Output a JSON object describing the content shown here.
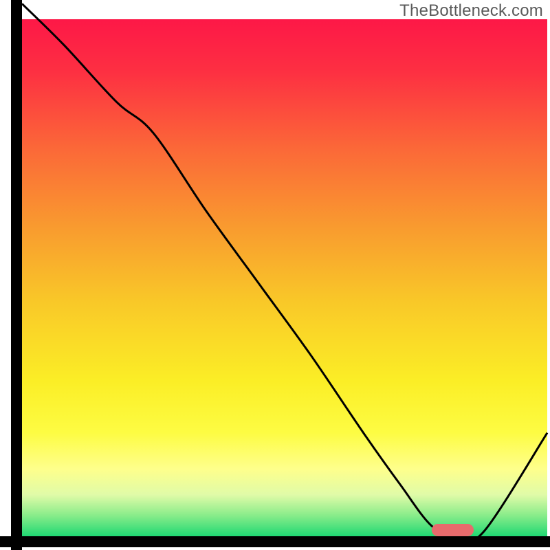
{
  "watermark": "TheBottleneck.com",
  "chart_data": {
    "type": "line",
    "title": "",
    "xlabel": "",
    "ylabel": "",
    "xlim": [
      0,
      100
    ],
    "ylim": [
      0,
      100
    ],
    "x": [
      0,
      8,
      18,
      25,
      35,
      45,
      55,
      65,
      72,
      78,
      83,
      88,
      100
    ],
    "values": [
      103,
      95,
      84,
      78,
      63,
      49,
      35,
      20,
      10,
      2,
      0,
      1,
      20
    ],
    "marker": {
      "x_start": 78,
      "x_end": 86,
      "y": 1.2
    },
    "gradient_stops": [
      {
        "offset": 0.0,
        "color": "#fd1847"
      },
      {
        "offset": 0.1,
        "color": "#fd2f42"
      },
      {
        "offset": 0.25,
        "color": "#fb6838"
      },
      {
        "offset": 0.4,
        "color": "#f99a2f"
      },
      {
        "offset": 0.55,
        "color": "#f9c928"
      },
      {
        "offset": 0.7,
        "color": "#fbee26"
      },
      {
        "offset": 0.8,
        "color": "#fdfc43"
      },
      {
        "offset": 0.87,
        "color": "#feff8c"
      },
      {
        "offset": 0.92,
        "color": "#e0fba8"
      },
      {
        "offset": 0.96,
        "color": "#88ec8a"
      },
      {
        "offset": 1.0,
        "color": "#1fd873"
      }
    ],
    "marker_color": "#e76a6c",
    "frame_color": "#000000",
    "line_color": "#000000"
  }
}
